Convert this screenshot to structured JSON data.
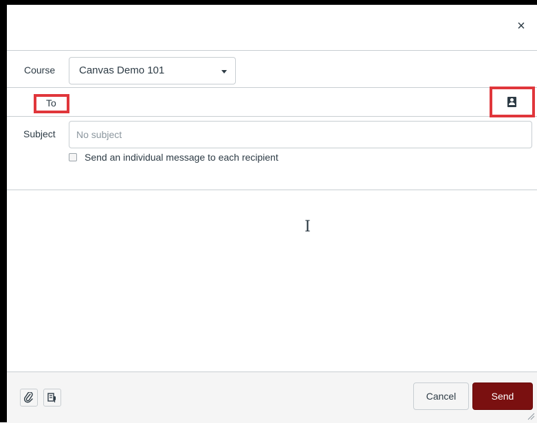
{
  "header": {
    "close_icon": "×"
  },
  "course": {
    "label": "Course",
    "selected": "Canvas Demo 101"
  },
  "to": {
    "label": "To",
    "value": ""
  },
  "subject": {
    "label": "Subject",
    "placeholder": "No subject",
    "value": ""
  },
  "individual_message": {
    "label": "Send an individual message to each recipient",
    "checked": false
  },
  "message": {
    "value": ""
  },
  "footer": {
    "attach_icon": "paperclip-icon",
    "media_icon": "media-record-icon",
    "cancel_label": "Cancel",
    "send_label": "Send"
  },
  "colors": {
    "highlight": "#e0363b",
    "send": "#7a1010"
  }
}
